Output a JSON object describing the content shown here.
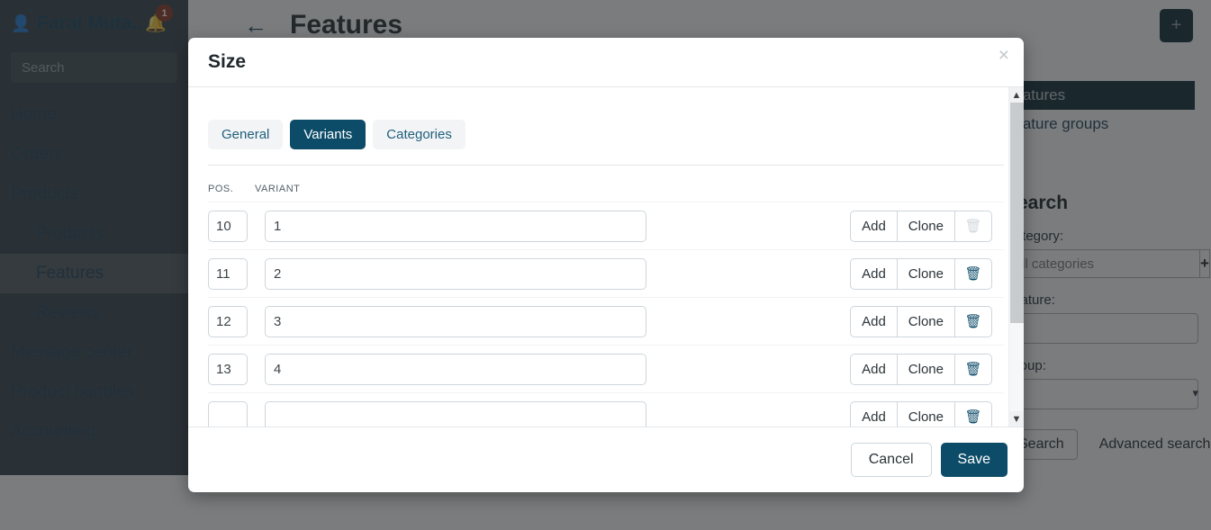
{
  "sidebar": {
    "user_name": "Farai Muta...",
    "user_icon": "person-icon",
    "bell_icon": "bell-icon",
    "notification_count": "1",
    "search_placeholder": "Search",
    "search_value": "",
    "search_icon": "search-icon",
    "items": [
      {
        "label": "Home",
        "level": "top",
        "active": false
      },
      {
        "label": "Orders",
        "level": "top",
        "active": false
      },
      {
        "label": "Products",
        "level": "top",
        "active": false
      },
      {
        "label": "Products",
        "level": "sub",
        "active": false
      },
      {
        "label": "Features",
        "level": "sub",
        "active": true
      },
      {
        "label": "Reviews",
        "level": "sub",
        "active": false
      },
      {
        "label": "Message center",
        "level": "top",
        "active": false
      },
      {
        "label": "Product bundles",
        "level": "top",
        "active": false
      },
      {
        "label": "Accounting",
        "level": "top",
        "active": false
      }
    ]
  },
  "topbar": {
    "back_icon": "back-arrow-icon",
    "title": "Features",
    "add_label": "+"
  },
  "right_panel": {
    "nav_active": "Features",
    "nav_second": "Feature groups",
    "search_heading": "Search",
    "category_label": "Category:",
    "category_placeholder": "All categories",
    "category_value": "",
    "plus_label": "+",
    "feature_label": "Feature:",
    "feature_value": "",
    "group_label": "Group:",
    "group_value": "",
    "search_button": "Search",
    "advanced_search": "Advanced search"
  },
  "modal": {
    "title": "Size",
    "close_label": "×",
    "tabs": [
      {
        "label": "General",
        "active": false
      },
      {
        "label": "Variants",
        "active": true
      },
      {
        "label": "Categories",
        "active": false
      }
    ],
    "table": {
      "headers": {
        "pos": "POS.",
        "variant": "VARIANT"
      },
      "rows": [
        {
          "pos": "10",
          "variant": "1",
          "add": "Add",
          "clone": "Clone",
          "delete_icon": "trash-icon",
          "delete_disabled": true
        },
        {
          "pos": "11",
          "variant": "2",
          "add": "Add",
          "clone": "Clone",
          "delete_icon": "trash-icon",
          "delete_disabled": false
        },
        {
          "pos": "12",
          "variant": "3",
          "add": "Add",
          "clone": "Clone",
          "delete_icon": "trash-icon",
          "delete_disabled": false
        },
        {
          "pos": "13",
          "variant": "4",
          "add": "Add",
          "clone": "Clone",
          "delete_icon": "trash-icon",
          "delete_disabled": false
        },
        {
          "pos": "",
          "variant": "",
          "add": "Add",
          "clone": "Clone",
          "delete_icon": "trash-icon",
          "delete_disabled": false
        }
      ]
    },
    "footer": {
      "cancel": "Cancel",
      "save": "Save"
    },
    "scrollbar": {
      "up_icon": "chevron-up-icon",
      "down_icon": "chevron-down-icon"
    }
  },
  "colors": {
    "accent": "#0d4c68",
    "sidebar_bg": "#2e3a42",
    "dark_nav": "#05232f",
    "badge": "#8a2f18"
  }
}
